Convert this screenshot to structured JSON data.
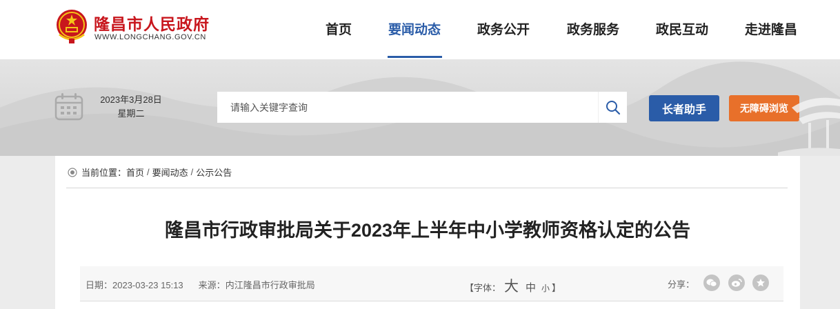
{
  "header": {
    "site_name": "隆昌市人民政府",
    "site_domain": "WWW.LONGCHANG.GOV.CN",
    "nav": [
      {
        "label": "首页",
        "active": false
      },
      {
        "label": "要闻动态",
        "active": true
      },
      {
        "label": "政务公开",
        "active": false
      },
      {
        "label": "政务服务",
        "active": false
      },
      {
        "label": "政民互动",
        "active": false
      },
      {
        "label": "走进隆昌",
        "active": false
      }
    ]
  },
  "banner": {
    "date": "2023年3月28日",
    "weekday": "星期二",
    "search_placeholder": "请输入关键字查询",
    "elder_button": "长者助手",
    "accessibility_button": "无障碍浏览"
  },
  "breadcrumb": {
    "prefix": "当前位置：",
    "items": [
      "首页",
      "要闻动态",
      "公示公告"
    ],
    "separator": "/"
  },
  "article": {
    "title": "隆昌市行政审批局关于2023年上半年中小学教师资格认定的公告",
    "date_label": "日期：",
    "date": "2023-03-23 15:13",
    "source_label": "来源：",
    "source": "内江隆昌市行政审批局",
    "font_label": "【字体：",
    "font_large": "大",
    "font_medium": "中",
    "font_small": "小",
    "font_close": "】",
    "share_label": "分享："
  },
  "icons": {
    "calendar": "calendar-icon",
    "search": "search-icon",
    "location": "location-icon",
    "share": [
      "wechat-icon",
      "weibo-icon",
      "favorite-icon"
    ]
  },
  "colors": {
    "brand_red": "#c8161d",
    "primary_blue": "#2a5ca8",
    "accent_orange": "#e8702a"
  }
}
